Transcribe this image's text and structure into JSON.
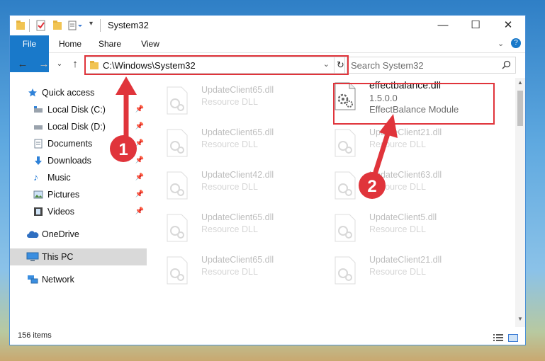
{
  "window": {
    "title": "System32"
  },
  "ribbon": {
    "tabs": [
      {
        "label": "File"
      },
      {
        "label": "Home"
      },
      {
        "label": "Share"
      },
      {
        "label": "View"
      }
    ]
  },
  "address": {
    "path": "C:\\Windows\\System32"
  },
  "search": {
    "placeholder": "Search System32"
  },
  "sidebar": {
    "items": [
      {
        "label": "Quick access"
      },
      {
        "label": "Local Disk (C:)"
      },
      {
        "label": "Local Disk (D:)"
      },
      {
        "label": "Documents"
      },
      {
        "label": "Downloads"
      },
      {
        "label": "Music"
      },
      {
        "label": "Pictures"
      },
      {
        "label": "Videos"
      },
      {
        "label": "OneDrive"
      },
      {
        "label": "This PC"
      },
      {
        "label": "Network"
      }
    ]
  },
  "files": {
    "highlighted": {
      "name": "effectbalance.dll",
      "version": "1.5.0.0",
      "description": "EffectBalance Module"
    },
    "left_column": [
      {
        "name": "UpdateClient65.dll",
        "desc": "Resource DLL"
      },
      {
        "name": "UpdateClient65.dll",
        "desc": "Resource DLL"
      },
      {
        "name": "UpdateClient42.dll",
        "desc": "Resource DLL"
      },
      {
        "name": "UpdateClient65.dll",
        "desc": "Resource DLL"
      },
      {
        "name": "UpdateClient65.dll",
        "desc": "Resource DLL"
      }
    ],
    "right_column": [
      {
        "name": "UpdateClient21.dll",
        "desc": "Resource DLL"
      },
      {
        "name": "UpdateClient63.dll",
        "desc": "Resource DLL"
      },
      {
        "name": "UpdateClient5.dll",
        "desc": "Resource DLL"
      },
      {
        "name": "UpdateClient21.dll",
        "desc": "Resource DLL"
      }
    ]
  },
  "status": {
    "item_count": "156 items"
  },
  "annotations": {
    "step1": "1",
    "step2": "2",
    "color": "#e0343b"
  }
}
